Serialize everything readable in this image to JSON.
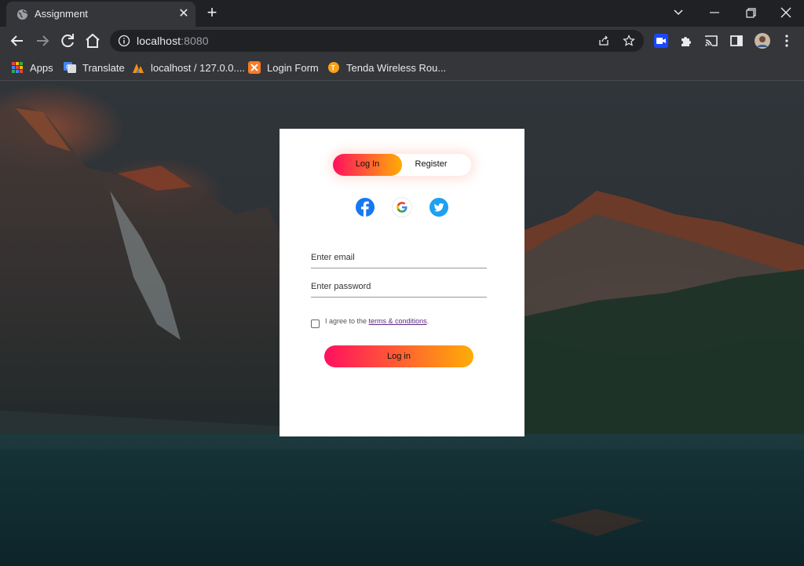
{
  "browser": {
    "tab": {
      "title": "Assignment"
    },
    "address": {
      "host": "localhost",
      "port": ":8080"
    },
    "bookmarks": [
      {
        "label": "Apps",
        "icon": "apps-grid-icon"
      },
      {
        "label": "Translate",
        "icon": "google-translate-icon"
      },
      {
        "label": "localhost / 127.0.0....",
        "icon": "phpmyadmin-icon"
      },
      {
        "label": "Login Form",
        "icon": "xampp-icon"
      },
      {
        "label": "Tenda Wireless Rou...",
        "icon": "tenda-icon"
      }
    ]
  },
  "login_card": {
    "toggle": {
      "login_label": "Log In",
      "register_label": "Register",
      "active": "Log In"
    },
    "social": [
      {
        "name": "facebook",
        "icon": "facebook-icon"
      },
      {
        "name": "google",
        "icon": "google-icon"
      },
      {
        "name": "twitter",
        "icon": "twitter-icon"
      }
    ],
    "email": {
      "placeholder": "Enter email",
      "value": ""
    },
    "password": {
      "placeholder": "Enter password",
      "value": ""
    },
    "agree": {
      "prefix": "I agree to the ",
      "link": "terms & conditions",
      "suffix": ".",
      "checked": false
    },
    "submit_label": "Log in"
  },
  "colors": {
    "gradient_start": "#ff105f",
    "gradient_end": "#ffad06",
    "chrome_dark": "#202124",
    "chrome_toolbar": "#35363a"
  }
}
